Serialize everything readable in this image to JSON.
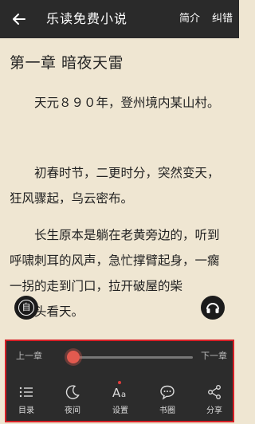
{
  "header": {
    "title": "乐读免费小说",
    "intro_label": "简介",
    "report_label": "纠错"
  },
  "reader": {
    "chapter_title": "第一章 暗夜天雷",
    "paragraphs": [
      "天元８９０年，登州境内某山村。",
      "初春时节，二更时分，突然变天，狂风骤起，乌云密布。",
      "长生原本是躺在老黄旁边的，听到呼啸刺耳的风声，急忙撑臂起身，一瘸一拐的走到门口，拉开破屋的柴",
      "头看天。"
    ],
    "auto_button_glyph": "自"
  },
  "panel": {
    "prev_chapter": "上一章",
    "next_chapter": "下一章",
    "progress": 0,
    "tools": [
      {
        "icon": "list-icon",
        "label": "目录"
      },
      {
        "icon": "moon-icon",
        "label": "夜间"
      },
      {
        "icon": "font-size-icon",
        "label": "设置"
      },
      {
        "icon": "chat-bubble-icon",
        "label": "书圈"
      },
      {
        "icon": "share-icon",
        "label": "分享"
      }
    ]
  },
  "colors": {
    "header_bg": "#2a2a2a",
    "page_bg": "#efe6d2",
    "panel_bg": "#2c2c2c",
    "highlight_border": "#d61f26",
    "slider_thumb": "#e25a4f"
  }
}
